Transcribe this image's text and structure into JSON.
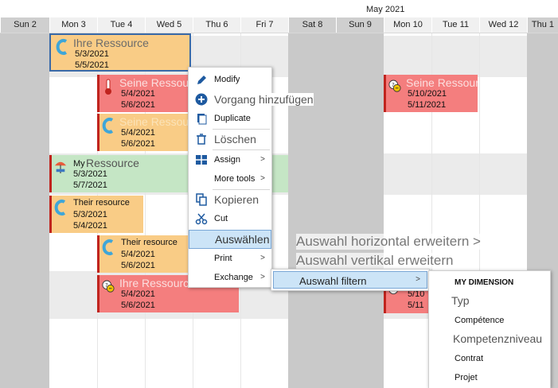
{
  "header": {
    "month": "May 2021",
    "days": [
      "Sun 2",
      "Mon 3",
      "Tue 4",
      "Wed 5",
      "Thu 6",
      "Fri 7",
      "Sat 8",
      "Sun 9",
      "Mon 10",
      "Tue 11",
      "Wed 12",
      "Thu 1"
    ]
  },
  "events": {
    "e1": {
      "name": "Ihre Ressource",
      "start": "5/3/2021",
      "end": "5/5/2021"
    },
    "e2": {
      "name": "Seine Ressource",
      "start": "5/4/2021",
      "end": "5/6/2021"
    },
    "e3": {
      "name": "Seine Ressource",
      "start": "5/4/2021",
      "end": "5/6/2021"
    },
    "e4": {
      "name_prefix": "My",
      "name": "Ressource",
      "start": "5/3/2021",
      "end": "5/7/2021"
    },
    "e5": {
      "name": "Their resource",
      "start": "5/3/2021",
      "end": "5/4/2021"
    },
    "e6": {
      "name": "Their resource",
      "start": "5/4/2021",
      "end": "5/6/2021"
    },
    "e7": {
      "name": "Ihre Ressource",
      "start": "5/4/2021",
      "end": "5/6/2021"
    },
    "e8": {
      "name": "Seine Ressource",
      "start": "5/10/2021",
      "end": "5/11/2021"
    },
    "e9": {
      "start": "5/10",
      "end": "5/11"
    }
  },
  "context_menu": {
    "modify": "Modify",
    "add_task": "Vorgang hinzufügen",
    "duplicate": "Duplicate",
    "delete": "Löschen",
    "assign": "Assign",
    "more_tools": "More tools",
    "copy": "Kopieren",
    "cut": "Cut",
    "select": "Auswählen",
    "print": "Print",
    "exchange": "Exchange",
    "arrow": ">"
  },
  "select_submenu": {
    "extend_horizontal": "Auswahl horizontal erweitern >",
    "extend_vertical": "Auswahl vertikal erweitern",
    "filter": "Auswahl filtern"
  },
  "filter_submenu": {
    "items": [
      "MY DIMENSION",
      "Typ",
      "Compétence",
      "Kompetenzniveau",
      "Contrat",
      "Projet"
    ]
  },
  "colors": {
    "orange": "#f9cc86",
    "red": "#f47e7e",
    "green": "#c5e6c5",
    "accent_bar": "#c0241e",
    "highlight": "#cce4f7"
  }
}
